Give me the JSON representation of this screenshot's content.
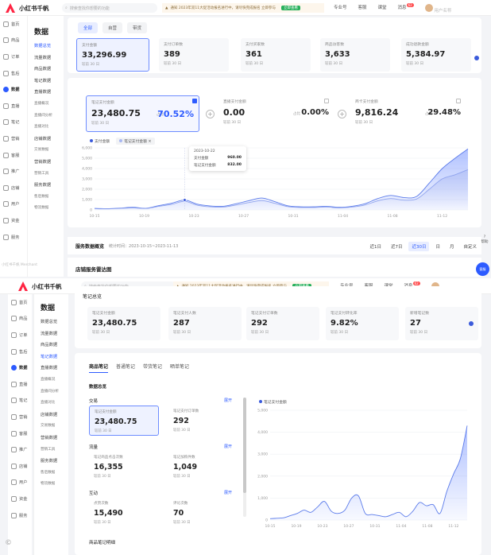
{
  "app": {
    "name": "小红书千帆",
    "brand_color": "#ff2442",
    "accent": "#2d5bff"
  },
  "top": {
    "search_placeholder": "搜索查找你想要的功能",
    "notice": "通知  2023年双11大促活动报名进行中，请尽快完成报名 立即参与",
    "notice_button": "立即查看",
    "menu": [
      "专业号",
      "客服",
      "课堂",
      "消息"
    ],
    "badge": "62",
    "user": "用户名称"
  },
  "iconbar": [
    "首页",
    "商品",
    "订单",
    "售后",
    "数据",
    "直播",
    "笔记",
    "营销",
    "客服",
    "推广",
    "店铺",
    "用户",
    "资金",
    "服务"
  ],
  "iconbar_active": "数据",
  "subnav": {
    "title": "数据",
    "items": [
      {
        "label": "数据总览",
        "small": false
      },
      {
        "label": "流量数据",
        "small": false
      },
      {
        "label": "商品数据",
        "small": false
      },
      {
        "label": "笔记数据",
        "small": false
      },
      {
        "label": "直播数据",
        "small": false
      },
      {
        "label": "直播概况",
        "small": true
      },
      {
        "label": "直播间分析",
        "small": true
      },
      {
        "label": "直播对比",
        "small": true
      },
      {
        "label": "店铺数据",
        "small": false
      },
      {
        "label": "交易数据",
        "small": true
      },
      {
        "label": "营销数据",
        "small": false
      },
      {
        "label": "营销工具",
        "small": true
      },
      {
        "label": "服务数据",
        "small": false
      },
      {
        "label": "售后数据",
        "small": true
      },
      {
        "label": "物流数据",
        "small": true
      }
    ],
    "selected_a": "数据总览",
    "selected_b": "笔记数据"
  },
  "overview": {
    "tabs": [
      "全部",
      "自营",
      "带货"
    ],
    "active_tab": "全部",
    "cards": [
      {
        "label": "支付金额",
        "value": "33,296.99",
        "sub": "较前 30 日"
      },
      {
        "label": "支付订单数",
        "value": "389",
        "sub": "较前 30 日"
      },
      {
        "label": "支付买家数",
        "value": "361",
        "sub": "较前 30 日"
      },
      {
        "label": "商品访客数",
        "value": "3,633",
        "sub": "较前 30 日"
      },
      {
        "label": "成功退款金额",
        "value": "5,384.97",
        "sub": "较前 30 日"
      }
    ]
  },
  "compare": {
    "cards": [
      {
        "label": "笔记支付金额",
        "value": "23,480.75",
        "sub": "较前 30 日",
        "pct_label": "占比",
        "pct": "70.52%"
      },
      {
        "label": "直播支付金额",
        "value": "0.00",
        "sub": "较前 30 日",
        "pct_label": "占比",
        "pct": "0.00%"
      },
      {
        "label": "商卡支付金额",
        "value": "9,816.24",
        "sub": "较前 30 日",
        "pct_label": "占比",
        "pct": "29.48%"
      }
    ],
    "legend": [
      "支付金额",
      "笔记支付金额"
    ]
  },
  "chart_a": {
    "type": "area",
    "x_ticks": [
      "10-15",
      "10-19",
      "10-23",
      "10-27",
      "10-31",
      "11-04",
      "11-08",
      "11-12"
    ],
    "y_ticks": [
      "6,000",
      "5,000",
      "4,000",
      "3,000",
      "2,000",
      "1,000",
      "0"
    ],
    "tooltip": {
      "date": "2023-10-22",
      "rows": [
        {
          "name": "支付金额",
          "value": "960.00"
        },
        {
          "name": "笔记支付金额",
          "value": "832.00"
        }
      ]
    }
  },
  "chart_data": [
    {
      "type": "area",
      "title": "",
      "x": [
        "10-15",
        "10-16",
        "10-17",
        "10-18",
        "10-19",
        "10-20",
        "10-21",
        "10-22",
        "10-23",
        "10-24",
        "10-25",
        "10-26",
        "10-27",
        "10-28",
        "10-29",
        "10-30",
        "10-31",
        "11-01",
        "11-02",
        "11-03",
        "11-04",
        "11-05",
        "11-06",
        "11-07",
        "11-08",
        "11-09",
        "11-10",
        "11-11",
        "11-12",
        "11-13"
      ],
      "series": [
        {
          "name": "支付金额",
          "values": [
            150,
            120,
            180,
            250,
            160,
            420,
            650,
            960,
            550,
            380,
            350,
            600,
            900,
            1150,
            800,
            400,
            300,
            300,
            350,
            250,
            350,
            600,
            1100,
            1400,
            1200,
            1300,
            2600,
            4000,
            5000,
            5900
          ]
        },
        {
          "name": "笔记支付金额",
          "values": [
            120,
            100,
            150,
            200,
            140,
            350,
            540,
            832,
            450,
            300,
            280,
            480,
            720,
            900,
            640,
            320,
            240,
            240,
            280,
            200,
            280,
            480,
            880,
            1100,
            950,
            1050,
            2000,
            3000,
            3400,
            3900
          ]
        }
      ],
      "ylim": [
        0,
        6000
      ]
    },
    {
      "type": "area",
      "title": "",
      "x": [
        "10-15",
        "10-16",
        "10-17",
        "10-18",
        "10-19",
        "10-20",
        "10-21",
        "10-22",
        "10-23",
        "10-24",
        "10-25",
        "10-26",
        "10-27",
        "10-28",
        "10-29",
        "10-30",
        "10-31",
        "11-01",
        "11-02",
        "11-03",
        "11-04",
        "11-05",
        "11-06",
        "11-07",
        "11-08",
        "11-09",
        "11-10",
        "11-11",
        "11-12",
        "11-13"
      ],
      "series": [
        {
          "name": "笔记支付金额",
          "values": [
            60,
            80,
            100,
            200,
            300,
            450,
            350,
            600,
            850,
            400,
            300,
            450,
            1000,
            1100,
            300,
            250,
            200,
            150,
            250,
            350,
            150,
            400,
            800,
            650,
            700,
            300,
            1300,
            2100,
            2800,
            4300
          ]
        }
      ],
      "ylim": [
        0,
        5000
      ]
    }
  ],
  "service_bar": {
    "title": "服务数据概览",
    "date": "统计时间：2023-10-15~2023-11-13",
    "periods": [
      "近1日",
      "近7日",
      "近30日",
      "日",
      "月",
      "自定义"
    ],
    "active_period": "近30日"
  },
  "heat_title": "店铺服务雷达图",
  "help": "帮助",
  "chat": "客服",
  "notes": {
    "section": "笔记总览",
    "cards": [
      {
        "label": "笔记支付金额",
        "value": "23,480.75",
        "sub": "较前 30 日"
      },
      {
        "label": "笔记支付人数",
        "value": "287",
        "sub": "较前 30 日"
      },
      {
        "label": "笔记支付订单数",
        "value": "292",
        "sub": "较前 30 日"
      },
      {
        "label": "笔记支付转化率",
        "value": "9.82%",
        "sub": "较前 30 日"
      },
      {
        "label": "新增笔记数",
        "value": "27",
        "sub": "较前 30 日"
      }
    ],
    "tabs": [
      "商品笔记",
      "普通笔记",
      "带货笔记",
      "晒单笔记"
    ],
    "active_tab": "商品笔记",
    "subtitle": "数据总览",
    "expand": "展开",
    "groups": [
      {
        "title": "交易",
        "cards": [
          {
            "label": "笔记支付金额",
            "value": "23,480.75",
            "sub": "较前 30 日"
          },
          {
            "label": "笔记支付订单数",
            "value": "292",
            "sub": "较前 30 日"
          }
        ]
      },
      {
        "title": "流量",
        "cards": [
          {
            "label": "笔记商品点击次数",
            "value": "16,355",
            "sub": "较前 30 日"
          },
          {
            "label": "笔记加购件数",
            "value": "1,049",
            "sub": "较前 30 日"
          }
        ]
      },
      {
        "title": "互动",
        "cards": [
          {
            "label": "点赞次数",
            "value": "15,490",
            "sub": "较前 30 日"
          },
          {
            "label": "评论次数",
            "value": "70",
            "sub": "较前 30 日"
          }
        ]
      }
    ],
    "chart_legend": "笔记支付金额",
    "x_ticks": [
      "10-15",
      "10-19",
      "10-23",
      "10-27",
      "10-31",
      "11-04",
      "11-08",
      "11-12"
    ],
    "y_ticks": [
      "5,000",
      "4,000",
      "3,000",
      "2,000",
      "1,000",
      "0"
    ],
    "footer": "商品笔记明细"
  },
  "watermark": "小红书千帆 Merchant"
}
